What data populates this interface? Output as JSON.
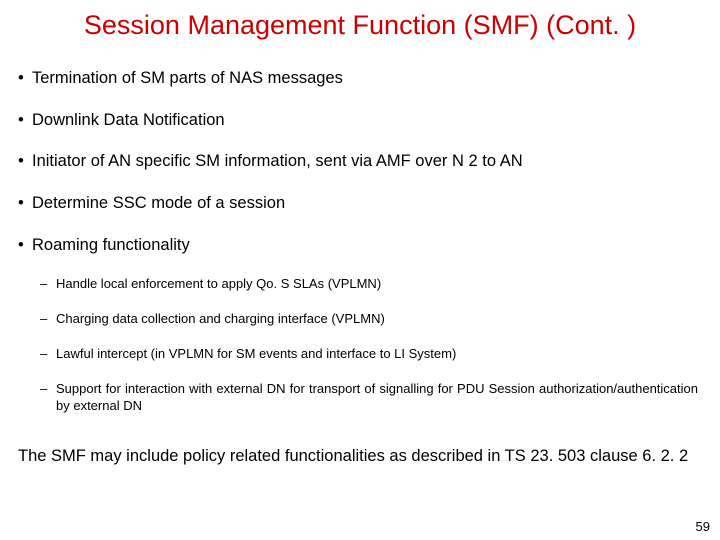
{
  "title": "Session Management Function (SMF) (Cont. )",
  "bullets": [
    "Termination of SM parts of NAS messages",
    "Downlink Data Notification",
    "Initiator of AN specific SM information, sent via AMF over N 2 to AN",
    "Determine SSC mode of a session",
    "Roaming functionality"
  ],
  "sub_bullets": [
    "Handle local enforcement to apply Qo. S SLAs (VPLMN)",
    "Charging data collection and charging interface (VPLMN)",
    "Lawful intercept (in VPLMN for SM events and interface to LI System)",
    "Support for interaction with external DN for transport of signalling for PDU Session authorization/authentication by external DN"
  ],
  "footer": "The SMF may include policy related functionalities as described in TS 23. 503 clause 6. 2. 2",
  "page_number": "59"
}
